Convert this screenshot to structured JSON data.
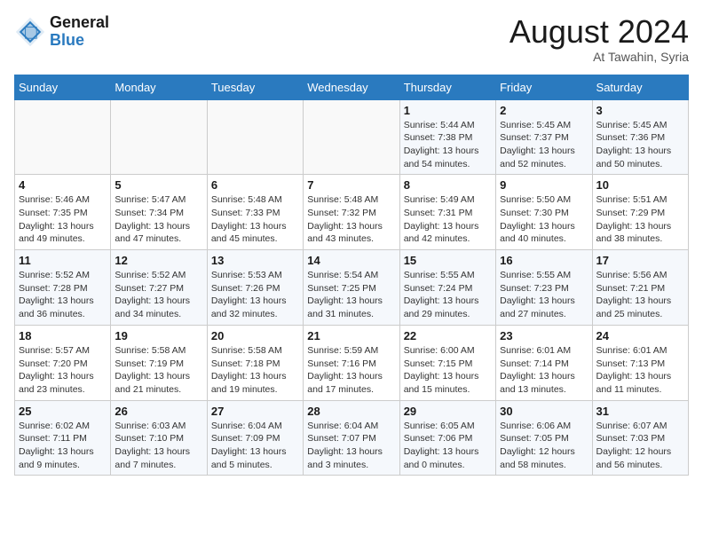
{
  "header": {
    "logo_line1": "General",
    "logo_line2": "Blue",
    "month_title": "August 2024",
    "subtitle": "At Tawahin, Syria"
  },
  "days_of_week": [
    "Sunday",
    "Monday",
    "Tuesday",
    "Wednesday",
    "Thursday",
    "Friday",
    "Saturday"
  ],
  "weeks": [
    [
      {
        "day": "",
        "info": ""
      },
      {
        "day": "",
        "info": ""
      },
      {
        "day": "",
        "info": ""
      },
      {
        "day": "",
        "info": ""
      },
      {
        "day": "1",
        "info": "Sunrise: 5:44 AM\nSunset: 7:38 PM\nDaylight: 13 hours\nand 54 minutes."
      },
      {
        "day": "2",
        "info": "Sunrise: 5:45 AM\nSunset: 7:37 PM\nDaylight: 13 hours\nand 52 minutes."
      },
      {
        "day": "3",
        "info": "Sunrise: 5:45 AM\nSunset: 7:36 PM\nDaylight: 13 hours\nand 50 minutes."
      }
    ],
    [
      {
        "day": "4",
        "info": "Sunrise: 5:46 AM\nSunset: 7:35 PM\nDaylight: 13 hours\nand 49 minutes."
      },
      {
        "day": "5",
        "info": "Sunrise: 5:47 AM\nSunset: 7:34 PM\nDaylight: 13 hours\nand 47 minutes."
      },
      {
        "day": "6",
        "info": "Sunrise: 5:48 AM\nSunset: 7:33 PM\nDaylight: 13 hours\nand 45 minutes."
      },
      {
        "day": "7",
        "info": "Sunrise: 5:48 AM\nSunset: 7:32 PM\nDaylight: 13 hours\nand 43 minutes."
      },
      {
        "day": "8",
        "info": "Sunrise: 5:49 AM\nSunset: 7:31 PM\nDaylight: 13 hours\nand 42 minutes."
      },
      {
        "day": "9",
        "info": "Sunrise: 5:50 AM\nSunset: 7:30 PM\nDaylight: 13 hours\nand 40 minutes."
      },
      {
        "day": "10",
        "info": "Sunrise: 5:51 AM\nSunset: 7:29 PM\nDaylight: 13 hours\nand 38 minutes."
      }
    ],
    [
      {
        "day": "11",
        "info": "Sunrise: 5:52 AM\nSunset: 7:28 PM\nDaylight: 13 hours\nand 36 minutes."
      },
      {
        "day": "12",
        "info": "Sunrise: 5:52 AM\nSunset: 7:27 PM\nDaylight: 13 hours\nand 34 minutes."
      },
      {
        "day": "13",
        "info": "Sunrise: 5:53 AM\nSunset: 7:26 PM\nDaylight: 13 hours\nand 32 minutes."
      },
      {
        "day": "14",
        "info": "Sunrise: 5:54 AM\nSunset: 7:25 PM\nDaylight: 13 hours\nand 31 minutes."
      },
      {
        "day": "15",
        "info": "Sunrise: 5:55 AM\nSunset: 7:24 PM\nDaylight: 13 hours\nand 29 minutes."
      },
      {
        "day": "16",
        "info": "Sunrise: 5:55 AM\nSunset: 7:23 PM\nDaylight: 13 hours\nand 27 minutes."
      },
      {
        "day": "17",
        "info": "Sunrise: 5:56 AM\nSunset: 7:21 PM\nDaylight: 13 hours\nand 25 minutes."
      }
    ],
    [
      {
        "day": "18",
        "info": "Sunrise: 5:57 AM\nSunset: 7:20 PM\nDaylight: 13 hours\nand 23 minutes."
      },
      {
        "day": "19",
        "info": "Sunrise: 5:58 AM\nSunset: 7:19 PM\nDaylight: 13 hours\nand 21 minutes."
      },
      {
        "day": "20",
        "info": "Sunrise: 5:58 AM\nSunset: 7:18 PM\nDaylight: 13 hours\nand 19 minutes."
      },
      {
        "day": "21",
        "info": "Sunrise: 5:59 AM\nSunset: 7:16 PM\nDaylight: 13 hours\nand 17 minutes."
      },
      {
        "day": "22",
        "info": "Sunrise: 6:00 AM\nSunset: 7:15 PM\nDaylight: 13 hours\nand 15 minutes."
      },
      {
        "day": "23",
        "info": "Sunrise: 6:01 AM\nSunset: 7:14 PM\nDaylight: 13 hours\nand 13 minutes."
      },
      {
        "day": "24",
        "info": "Sunrise: 6:01 AM\nSunset: 7:13 PM\nDaylight: 13 hours\nand 11 minutes."
      }
    ],
    [
      {
        "day": "25",
        "info": "Sunrise: 6:02 AM\nSunset: 7:11 PM\nDaylight: 13 hours\nand 9 minutes."
      },
      {
        "day": "26",
        "info": "Sunrise: 6:03 AM\nSunset: 7:10 PM\nDaylight: 13 hours\nand 7 minutes."
      },
      {
        "day": "27",
        "info": "Sunrise: 6:04 AM\nSunset: 7:09 PM\nDaylight: 13 hours\nand 5 minutes."
      },
      {
        "day": "28",
        "info": "Sunrise: 6:04 AM\nSunset: 7:07 PM\nDaylight: 13 hours\nand 3 minutes."
      },
      {
        "day": "29",
        "info": "Sunrise: 6:05 AM\nSunset: 7:06 PM\nDaylight: 13 hours\nand 0 minutes."
      },
      {
        "day": "30",
        "info": "Sunrise: 6:06 AM\nSunset: 7:05 PM\nDaylight: 12 hours\nand 58 minutes."
      },
      {
        "day": "31",
        "info": "Sunrise: 6:07 AM\nSunset: 7:03 PM\nDaylight: 12 hours\nand 56 minutes."
      }
    ]
  ]
}
